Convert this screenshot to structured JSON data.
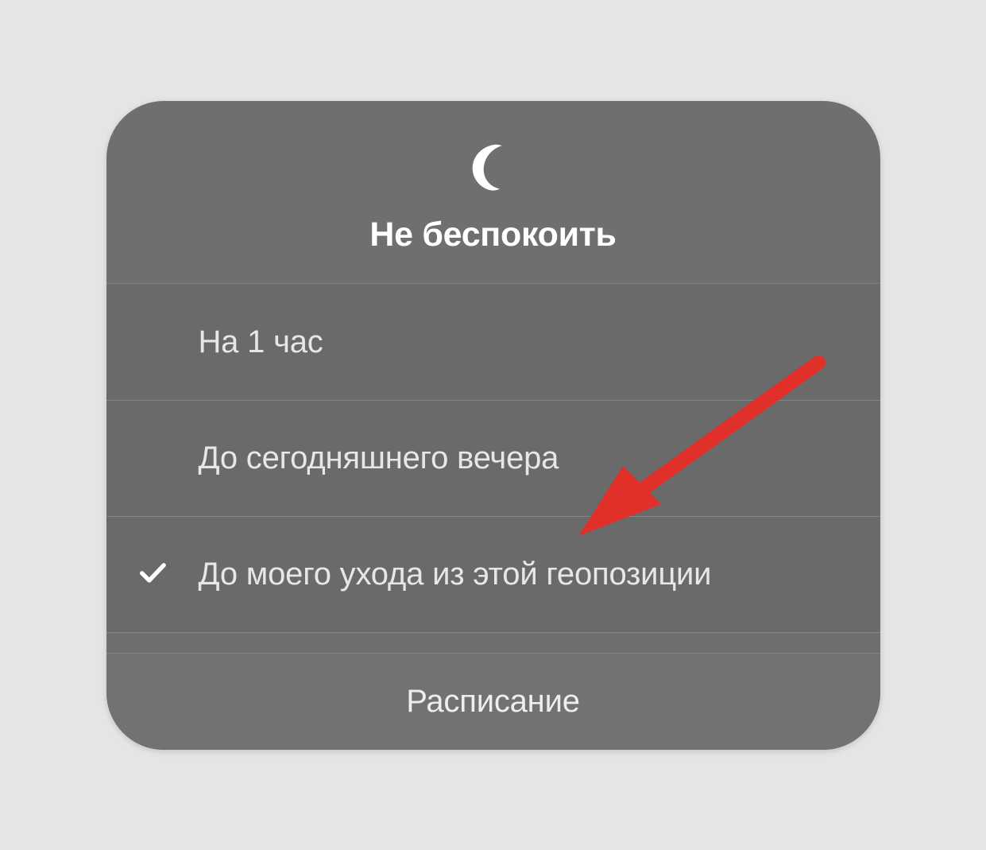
{
  "panel": {
    "title": "Не беспокоить",
    "options": [
      {
        "label": "На 1 час",
        "selected": false
      },
      {
        "label": "До сегодняшнего вечера",
        "selected": false
      },
      {
        "label": "До моего ухода из этой геопозиции",
        "selected": true
      }
    ],
    "schedule_label": "Расписание"
  },
  "icons": {
    "moon": "moon-icon",
    "check": "check-icon",
    "annotation_arrow": "annotation-arrow-icon"
  },
  "colors": {
    "background": "#e5e5e5",
    "panel": "#6f6f6f",
    "panel_options": "#6a6a6a",
    "panel_footer": "#727272",
    "text_primary": "#ffffff",
    "text_secondary": "#e7e7e7",
    "annotation": "#e1302a"
  }
}
